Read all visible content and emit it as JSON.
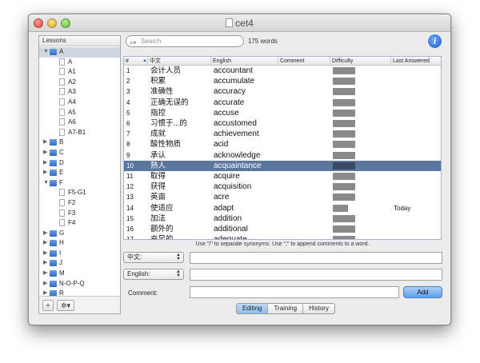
{
  "window": {
    "title": "cet4"
  },
  "sidebar": {
    "header": "Lessons",
    "rows": [
      {
        "label": "A",
        "type": "folder",
        "expanded": true,
        "selected": true,
        "level": 0
      },
      {
        "label": "A",
        "type": "doc",
        "level": 1
      },
      {
        "label": "A1",
        "type": "doc",
        "level": 1
      },
      {
        "label": "A2",
        "type": "doc",
        "level": 1
      },
      {
        "label": "A3",
        "type": "doc",
        "level": 1
      },
      {
        "label": "A4",
        "type": "doc",
        "level": 1
      },
      {
        "label": "A5",
        "type": "doc",
        "level": 1
      },
      {
        "label": "A6",
        "type": "doc",
        "level": 1
      },
      {
        "label": "A7-B1",
        "type": "doc",
        "level": 1
      },
      {
        "label": "B",
        "type": "folder",
        "expanded": false,
        "level": 0
      },
      {
        "label": "C",
        "type": "folder",
        "expanded": false,
        "level": 0
      },
      {
        "label": "D",
        "type": "folder",
        "expanded": false,
        "level": 0
      },
      {
        "label": "E",
        "type": "folder",
        "expanded": false,
        "level": 0
      },
      {
        "label": "F",
        "type": "folder",
        "expanded": true,
        "level": 0
      },
      {
        "label": "F5-G1",
        "type": "doc",
        "level": 1
      },
      {
        "label": "F2",
        "type": "doc",
        "level": 1
      },
      {
        "label": "F3",
        "type": "doc",
        "level": 1
      },
      {
        "label": "F4",
        "type": "doc",
        "level": 1
      },
      {
        "label": "G",
        "type": "folder",
        "expanded": false,
        "level": 0
      },
      {
        "label": "H",
        "type": "folder",
        "expanded": false,
        "level": 0
      },
      {
        "label": "I",
        "type": "folder",
        "expanded": false,
        "level": 0
      },
      {
        "label": "J",
        "type": "folder",
        "expanded": false,
        "level": 0
      },
      {
        "label": "M",
        "type": "folder",
        "expanded": false,
        "level": 0
      },
      {
        "label": "N-O-P-Q",
        "type": "folder",
        "expanded": false,
        "level": 0
      },
      {
        "label": "R",
        "type": "folder",
        "expanded": false,
        "level": 0
      }
    ],
    "add_label": "+",
    "action_label": "✲▾"
  },
  "search": {
    "placeholder": "Search",
    "count": "175 words"
  },
  "table": {
    "columns": {
      "num": "#",
      "zh": "中文",
      "en": "English",
      "comment": "Comment",
      "difficulty": "Difficulty",
      "last": "Last Answered"
    },
    "rows": [
      {
        "n": "1",
        "zh": "会计人员",
        "en": "accountant",
        "difficulty": 1.0,
        "last": ""
      },
      {
        "n": "2",
        "zh": "积累",
        "en": "accumulate",
        "difficulty": 1.0,
        "last": ""
      },
      {
        "n": "3",
        "zh": "准确性",
        "en": "accuracy",
        "difficulty": 1.0,
        "last": ""
      },
      {
        "n": "4",
        "zh": "正确无误的",
        "en": "accurate",
        "difficulty": 1.0,
        "last": ""
      },
      {
        "n": "5",
        "zh": "指控",
        "en": "accuse",
        "difficulty": 1.0,
        "last": ""
      },
      {
        "n": "6",
        "zh": "习惯于...的",
        "en": "accustomed",
        "difficulty": 1.0,
        "last": ""
      },
      {
        "n": "7",
        "zh": "成就",
        "en": "achievement",
        "difficulty": 1.0,
        "last": ""
      },
      {
        "n": "8",
        "zh": "酸性物质",
        "en": "acid",
        "difficulty": 1.0,
        "last": ""
      },
      {
        "n": "9",
        "zh": "承认",
        "en": "acknowledge",
        "difficulty": 1.0,
        "last": ""
      },
      {
        "n": "10",
        "zh": "熟人",
        "en": "acquaintance",
        "difficulty": 1.0,
        "last": "",
        "selected": true
      },
      {
        "n": "11",
        "zh": "取得",
        "en": "acquire",
        "difficulty": 1.0,
        "last": ""
      },
      {
        "n": "12",
        "zh": "获得",
        "en": "acquisition",
        "difficulty": 1.0,
        "last": ""
      },
      {
        "n": "13",
        "zh": "英亩",
        "en": "acre",
        "difficulty": 1.0,
        "last": ""
      },
      {
        "n": "14",
        "zh": "使适应",
        "en": "adapt",
        "difficulty": 0.68,
        "last": "Today"
      },
      {
        "n": "15",
        "zh": "加法",
        "en": "addition",
        "difficulty": 1.0,
        "last": ""
      },
      {
        "n": "16",
        "zh": "额外的",
        "en": "additional",
        "difficulty": 1.0,
        "last": ""
      },
      {
        "n": "17",
        "zh": "充足的",
        "en": "adequate",
        "difficulty": 1.0,
        "last": ""
      }
    ]
  },
  "hint": "Use \"/\" to separate synonyms. Use \";\" to append comments to a word.",
  "form": {
    "zh_popup": "中文:",
    "en_popup": "English:",
    "comment_label": "Comment:",
    "add_label": "Add"
  },
  "tabs": [
    "Editing",
    "Training",
    "History"
  ],
  "colors": {
    "selection": "#5d76a0",
    "accent": "#5d9fe8"
  }
}
